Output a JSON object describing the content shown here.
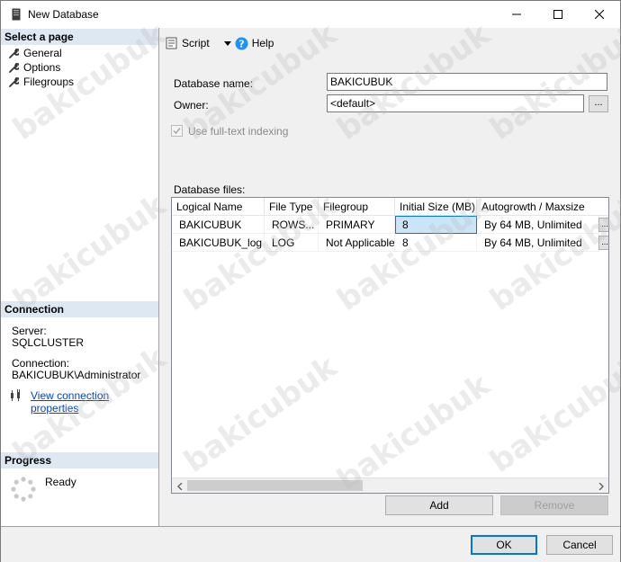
{
  "window": {
    "title": "New Database",
    "controls": {
      "minimize": "—",
      "maximize": "☐",
      "close": "✕"
    }
  },
  "left_pane": {
    "select_page_header": "Select a page",
    "pages": [
      {
        "label": "General"
      },
      {
        "label": "Options"
      },
      {
        "label": "Filegroups"
      }
    ],
    "connection_header": "Connection",
    "server_label": "Server:",
    "server_value": "SQLCLUSTER",
    "connection_label": "Connection:",
    "connection_value": "BAKICUBUK\\Administrator",
    "view_connection_link": "View connection properties",
    "progress_header": "Progress",
    "progress_status": "Ready"
  },
  "toolbar": {
    "script_label": "Script",
    "help_label": "Help"
  },
  "form": {
    "database_name_label": "Database name:",
    "database_name_value": "BAKICUBUK",
    "owner_label": "Owner:",
    "owner_value": "<default>",
    "owner_browse": "...",
    "fulltext_label": "Use full-text indexing",
    "fulltext_checked": true,
    "database_files_label": "Database files:"
  },
  "files_table": {
    "columns": [
      "Logical Name",
      "File Type",
      "Filegroup",
      "Initial Size (MB)",
      "Autogrowth / Maxsize"
    ],
    "rows": [
      [
        "BAKICUBUK",
        "ROWS...",
        "PRIMARY",
        "8",
        "By 64 MB, Unlimited"
      ],
      [
        "BAKICUBUK_log",
        "LOG",
        "Not Applicable",
        "8",
        "By 64 MB, Unlimited"
      ]
    ],
    "row_ellipsis": "..."
  },
  "buttons": {
    "add": "Add",
    "remove": "Remove",
    "ok": "OK",
    "cancel": "Cancel"
  },
  "watermark_text": "bakicubuk",
  "colors": {
    "section_header_bg": "#dde8f3",
    "link": "#0645c8",
    "selection_bg": "#cce4f7",
    "accent": "#0078d7",
    "help_icon": "#1e90ff"
  }
}
